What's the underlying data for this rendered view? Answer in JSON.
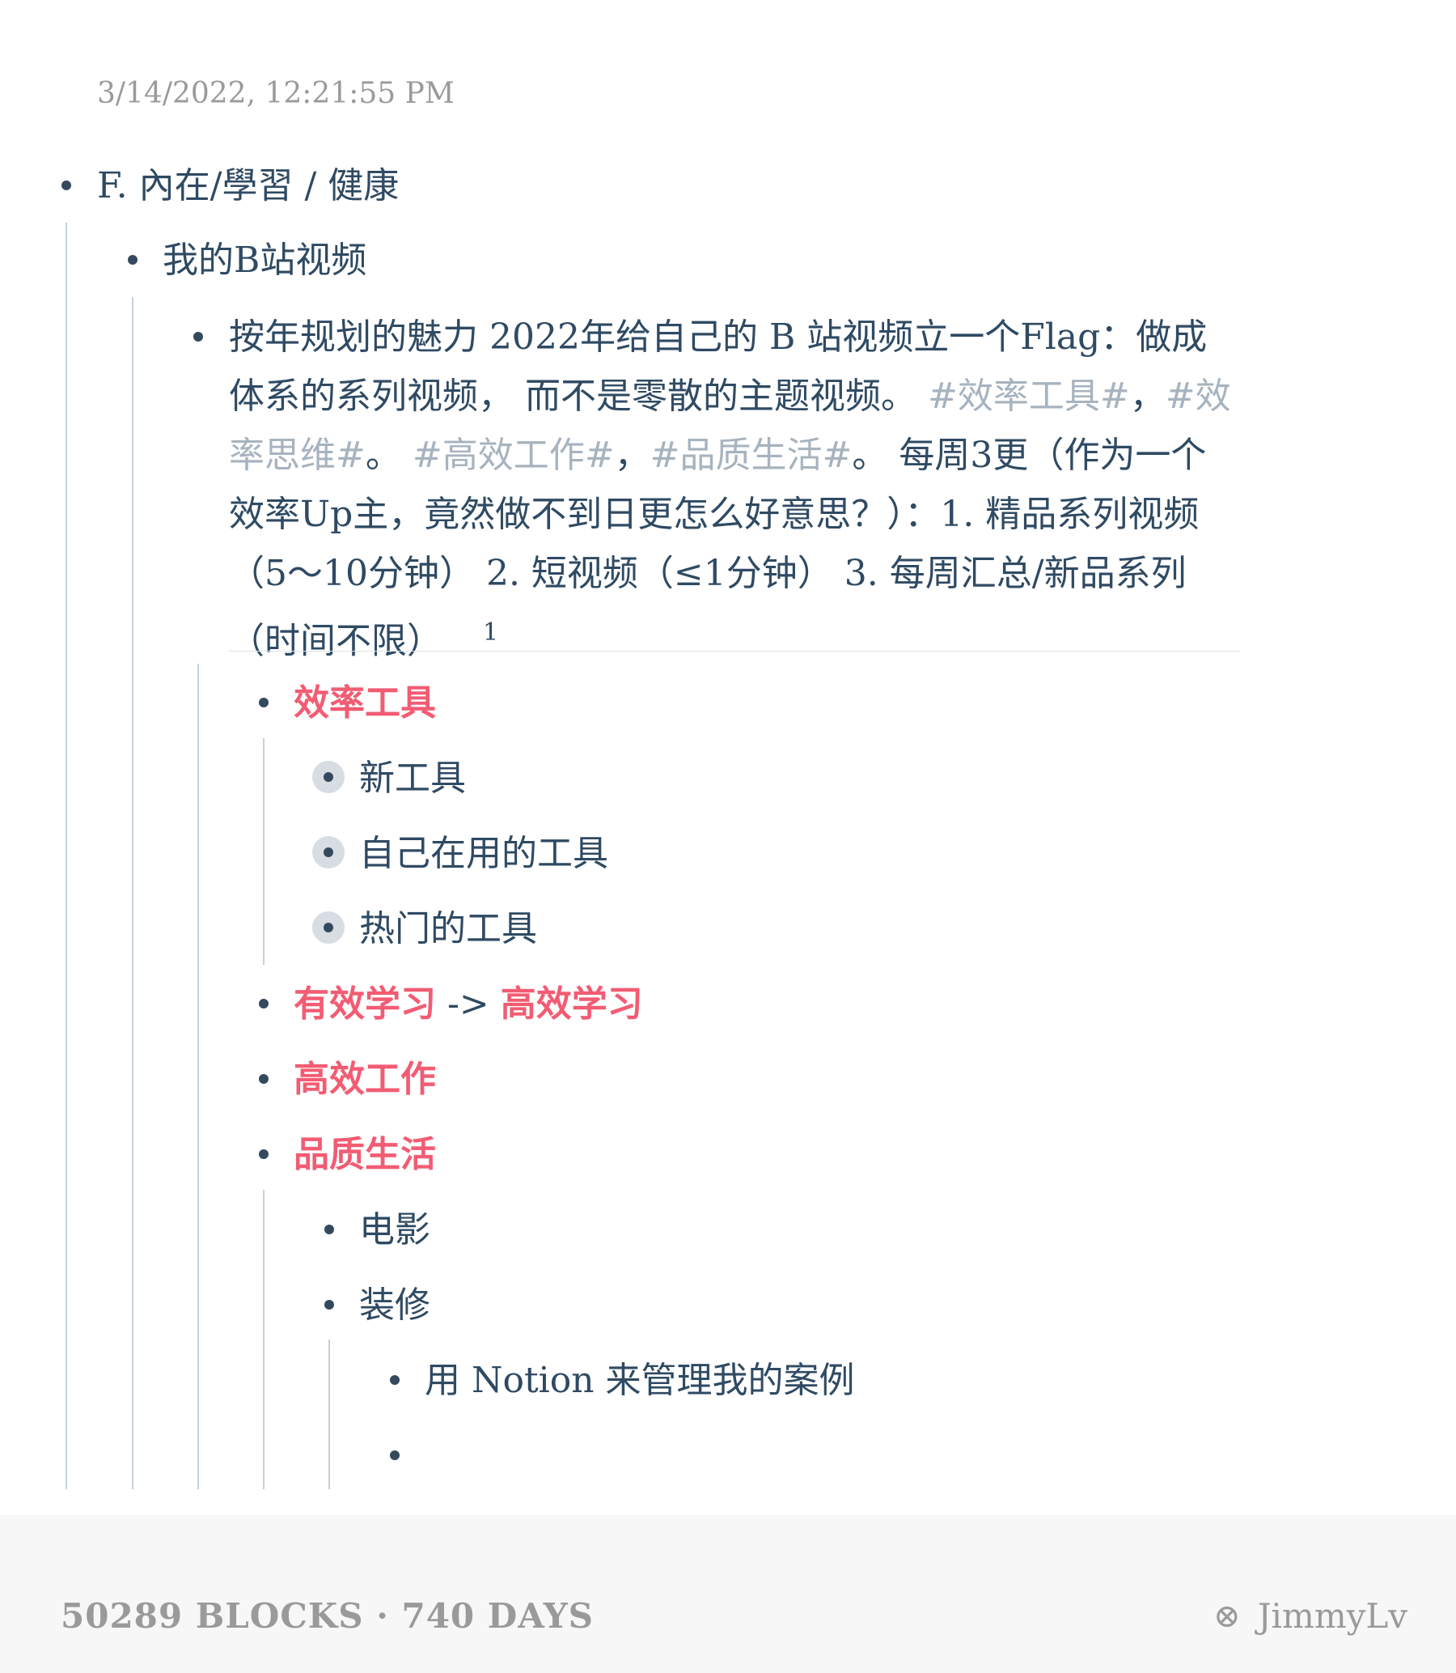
{
  "timestamp": "3/14/2022, 12:21:55 PM",
  "outline": {
    "level1": "F. 內在/學習 / 健康",
    "level2": "我的B站视频",
    "level3_paragraph": {
      "intro": " 按年规划的魅力  2022年给自己的 B 站视频立一个Flag：做成体系的系列视频， 而不是零散的主题视频。 ",
      "tag1": "#效率工具#",
      "sep1": "，",
      "tag2": "#效率思维#",
      "sep2": "。 ",
      "tag3": "#高效工作#",
      "sep3": "，",
      "tag4": "#品质生活#",
      "rest": "。 每周3更（作为一个效率Up主，竟然做不到日更怎么好意思？）：1. 精品系列视频（5～10分钟） 2. 短视频（≤1分钟） 3. 每周汇总/新品系列（时间不限）",
      "sup": "1"
    },
    "efficiency_tools": {
      "label": "效率工具",
      "children": [
        "新工具",
        "自己在用的工具",
        "热门的工具"
      ]
    },
    "learning": {
      "label_a": "有效学习",
      "arrow": " -> ",
      "label_b": "高效学习"
    },
    "efficient_work": "高效工作",
    "quality_life": {
      "label": "品质生活",
      "children": {
        "movie": "电影",
        "decoration": "装修",
        "decoration_children": [
          "用 Notion 来管理我的案例",
          ""
        ]
      }
    }
  },
  "footer": {
    "stats": "50289 BLOCKS · 740 DAYS",
    "user": "JimmyLv",
    "icon": "settings-cross-icon"
  }
}
